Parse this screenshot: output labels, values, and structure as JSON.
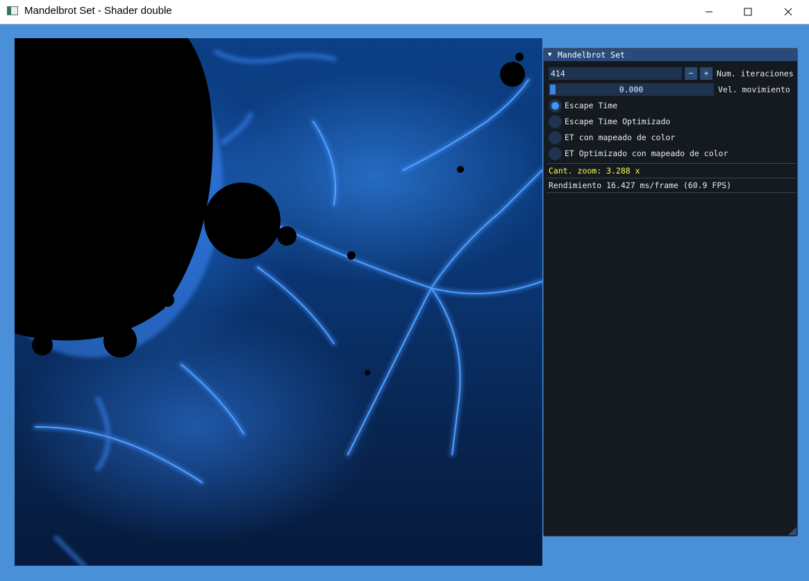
{
  "window": {
    "title": "Mandelbrot Set - Shader double",
    "icon": "app-window-icon",
    "controls": [
      "minimize-icon",
      "maximize-icon",
      "close-icon"
    ]
  },
  "fractal": {
    "description_colors": {
      "set": "#000000",
      "glow": "#3d8cff",
      "background": "#0a3572"
    }
  },
  "panel": {
    "title": "Mandelbrot Set",
    "iterations": {
      "value": "414",
      "minus_label": "−",
      "plus_label": "+",
      "label": "Num. iteraciones"
    },
    "speed": {
      "value": "0.000",
      "label": "Vel. movimiento",
      "fraction": 0.0
    },
    "algorithms": [
      {
        "label": "Escape Time",
        "selected": true
      },
      {
        "label": "Escape Time Optimizado",
        "selected": false
      },
      {
        "label": "ET con mapeado de color",
        "selected": false
      },
      {
        "label": "ET Optimizado con mapeado de color",
        "selected": false
      }
    ],
    "zoom_text": "Cant. zoom: 3.288 x",
    "performance_text": "Rendimiento 16.427 ms/frame (60.9 FPS)"
  },
  "colors": {
    "desktop": "#4a90d9",
    "panel_bg": "#141a20",
    "header": "#294a7a",
    "accent": "#4296fa",
    "zoom_text": "#ffff44"
  }
}
